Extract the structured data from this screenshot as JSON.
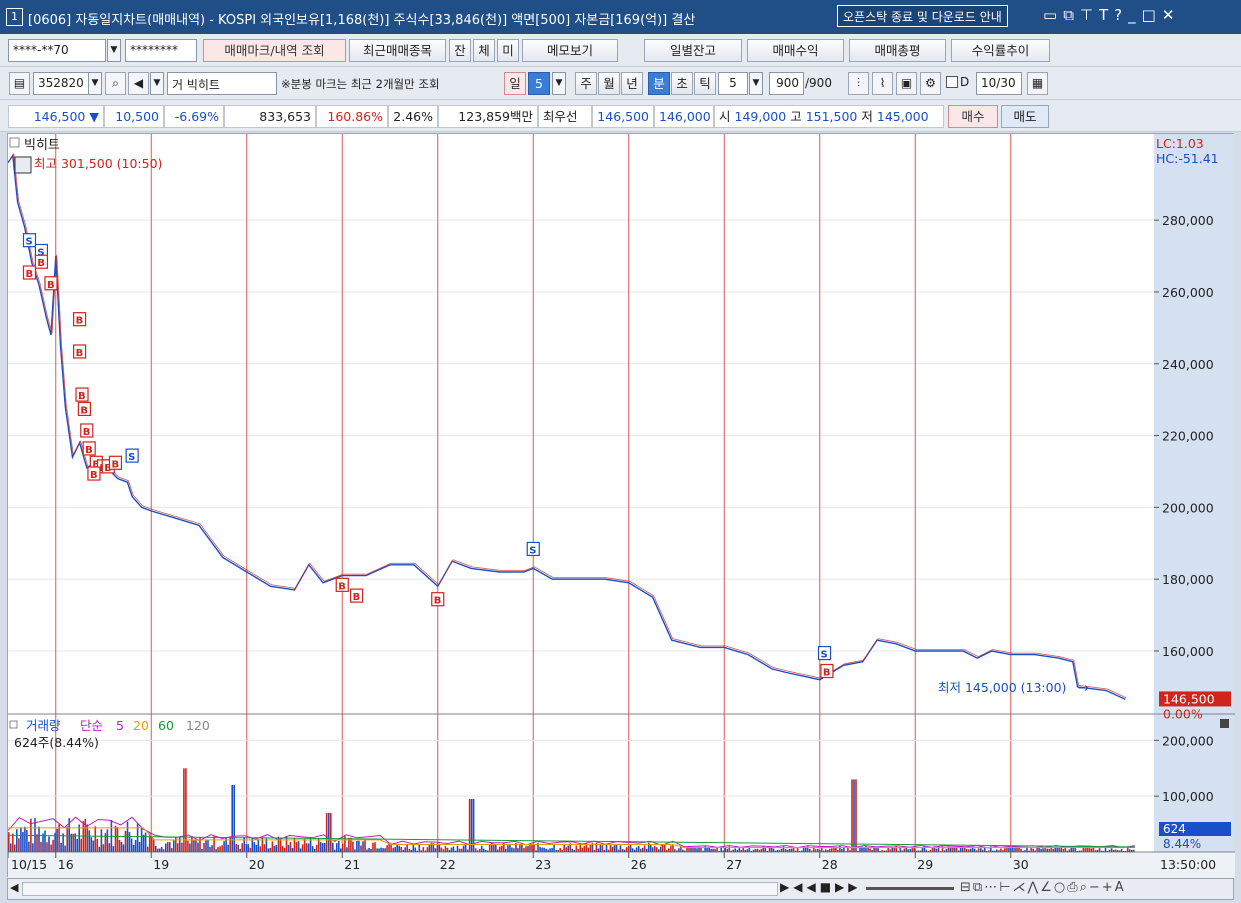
{
  "window": {
    "screen_no": "1",
    "title": "[0606] 자동일지차트(매매내역) - KOSPI 외국인보유[1,168(천)] 주식수[33,846(천)] 액면[500] 자본금[169(억)] 결산",
    "notice_button": "오픈스탁 종료 및 다운로드 안내",
    "icons": [
      "restore-down-icon",
      "cascade-icon",
      "pin-icon",
      "font-icon",
      "help-icon",
      "minimize-icon",
      "maximize-icon",
      "close-icon"
    ]
  },
  "row1": {
    "account": "****-**70",
    "password": "********",
    "buttons": [
      "매매마크/내역 조회",
      "최근매매종목",
      "잔",
      "체",
      "미",
      "메모보기",
      "일별잔고",
      "매매수익",
      "매매총평",
      "수익률추이"
    ]
  },
  "row2": {
    "code": "352820",
    "name": "거 빅히트",
    "note": "※분봉 마크는 최근 2개월만 조회",
    "period_buttons": [
      "일",
      "5",
      "주",
      "월",
      "년",
      "분",
      "초",
      "틱"
    ],
    "interval": "5",
    "count": "900",
    "count_total": "/900",
    "date": "10/30",
    "d_label": "D"
  },
  "quote": {
    "price": "146,500",
    "change": "10,500",
    "change_pct": "-6.69%",
    "volume": "833,653",
    "vol_ratio": "160.86%",
    "turnover": "2.46%",
    "amount": "123,859백만",
    "best_label": "최우선",
    "best_ask": "146,500",
    "best_bid": "146,000",
    "open_label": "시",
    "open": "149,000",
    "high_label": "고",
    "high": "151,500",
    "low_label": "저",
    "low": "145,000",
    "buy_label": "매수",
    "sell_label": "매도"
  },
  "chart_data": {
    "type": "line",
    "stock_label": "빅히트",
    "lc": "LC:1.03",
    "hc": "HC:-51.41",
    "high_label": "최고 301,500 (10:50)",
    "low_label": "최저 145,000 (13:00)",
    "current_price": "146,500",
    "current_pct": "0.00%",
    "ylim": [
      143000,
      304000
    ],
    "y_ticks": [
      160000,
      180000,
      200000,
      220000,
      240000,
      260000,
      280000
    ],
    "y_tick_labels": [
      "160,000",
      "180,000",
      "200,000",
      "220,000",
      "240,000",
      "260,000",
      "280,000"
    ],
    "date_labels": [
      "10/15",
      "16",
      "19",
      "20",
      "21",
      "22",
      "23",
      "26",
      "27",
      "28",
      "29",
      "30"
    ],
    "time_label": "13:50:00",
    "price_path": [
      [
        0,
        296000
      ],
      [
        0.1,
        298000
      ],
      [
        0.2,
        285000
      ],
      [
        0.35,
        278000
      ],
      [
        0.5,
        268000
      ],
      [
        0.65,
        262000
      ],
      [
        0.8,
        253000
      ],
      [
        0.9,
        248000
      ],
      [
        1.0,
        270000
      ],
      [
        1.1,
        245000
      ],
      [
        1.2,
        228000
      ],
      [
        1.35,
        214000
      ],
      [
        1.5,
        218000
      ],
      [
        1.65,
        211000
      ],
      [
        1.8,
        212000
      ],
      [
        2.0,
        212000
      ],
      [
        2.3,
        208000
      ],
      [
        2.5,
        207000
      ],
      [
        2.6,
        203000
      ],
      [
        2.8,
        200000
      ],
      [
        3.0,
        199000
      ],
      [
        3.5,
        197000
      ],
      [
        4.0,
        195000
      ],
      [
        4.5,
        186000
      ],
      [
        5.0,
        182000
      ],
      [
        5.5,
        178000
      ],
      [
        6.0,
        177000
      ],
      [
        6.3,
        184000
      ],
      [
        6.6,
        179000
      ],
      [
        7.0,
        181000
      ],
      [
        7.5,
        181000
      ],
      [
        8.0,
        184000
      ],
      [
        8.5,
        184000
      ],
      [
        9.0,
        178000
      ],
      [
        9.3,
        185000
      ],
      [
        9.7,
        183000
      ],
      [
        10.3,
        182000
      ],
      [
        10.8,
        182000
      ],
      [
        11.0,
        183000
      ],
      [
        11.4,
        180000
      ],
      [
        12.0,
        180000
      ],
      [
        12.5,
        180000
      ],
      [
        13.0,
        179000
      ],
      [
        13.5,
        175000
      ],
      [
        13.9,
        163000
      ],
      [
        14.5,
        161000
      ],
      [
        15.0,
        161000
      ],
      [
        15.5,
        159000
      ],
      [
        16.0,
        155000
      ],
      [
        16.3,
        154000
      ],
      [
        17.0,
        152000
      ],
      [
        17.5,
        156000
      ],
      [
        17.9,
        157000
      ],
      [
        18.2,
        163000
      ],
      [
        18.6,
        162000
      ],
      [
        19.0,
        160000
      ],
      [
        19.5,
        160000
      ],
      [
        20.0,
        160000
      ],
      [
        20.3,
        158000
      ],
      [
        20.6,
        160000
      ],
      [
        21.0,
        159000
      ],
      [
        21.5,
        159000
      ],
      [
        22.0,
        158000
      ],
      [
        22.3,
        157000
      ],
      [
        22.4,
        150000
      ],
      [
        23.0,
        149000
      ],
      [
        23.4,
        146500
      ]
    ],
    "day_lines": [
      1,
      3,
      5,
      7,
      9,
      11,
      13,
      15,
      17,
      19,
      21
    ],
    "markers": [
      {
        "t": "S",
        "x": 0.45,
        "y": 274000
      },
      {
        "t": "S",
        "x": 0.7,
        "y": 271000
      },
      {
        "t": "B",
        "x": 0.45,
        "y": 265000
      },
      {
        "t": "B",
        "x": 0.7,
        "y": 268000
      },
      {
        "t": "B",
        "x": 0.9,
        "y": 262000
      },
      {
        "t": "B",
        "x": 1.5,
        "y": 252000
      },
      {
        "t": "B",
        "x": 1.5,
        "y": 243000
      },
      {
        "t": "B",
        "x": 1.55,
        "y": 231000
      },
      {
        "t": "B",
        "x": 1.6,
        "y": 227000
      },
      {
        "t": "B",
        "x": 1.65,
        "y": 221000
      },
      {
        "t": "B",
        "x": 1.7,
        "y": 216000
      },
      {
        "t": "B",
        "x": 1.85,
        "y": 212000
      },
      {
        "t": "B",
        "x": 2.0,
        "y": 211000
      },
      {
        "t": "B",
        "x": 2.1,
        "y": 211000
      },
      {
        "t": "B",
        "x": 2.25,
        "y": 212000
      },
      {
        "t": "B",
        "x": 1.8,
        "y": 209000
      },
      {
        "t": "S",
        "x": 2.6,
        "y": 214000
      },
      {
        "t": "B",
        "x": 7.0,
        "y": 178000
      },
      {
        "t": "B",
        "x": 7.3,
        "y": 175000
      },
      {
        "t": "B",
        "x": 9.0,
        "y": 174000
      },
      {
        "t": "S",
        "x": 11.0,
        "y": 188000
      },
      {
        "t": "S",
        "x": 17.1,
        "y": 159000
      },
      {
        "t": "B",
        "x": 17.15,
        "y": 154000
      }
    ],
    "volume_panel": {
      "label": "거래량",
      "ma_label": "단순",
      "ma_periods": [
        "5",
        "20",
        "60",
        "120"
      ],
      "info": "624주(8.44%)",
      "y_ticks": [
        100000,
        200000
      ],
      "y_tick_labels": [
        "100,000",
        "200,000"
      ],
      "ylim": [
        0,
        240000
      ],
      "current": "624",
      "current_pct": "8.44%"
    }
  },
  "bottom": {
    "icons": [
      "scroll-left-icon",
      "play-icon",
      "rewind-icon",
      "stop-icon",
      "fast-forward-icon",
      "zoom-slider-icon",
      "chart-icon-1",
      "chart-icon-2",
      "chart-icon-3",
      "draw-line-icon",
      "draw-fan-icon",
      "draw-trend-icon",
      "draw-angle-icon",
      "draw-circle-icon",
      "snapshot-icon",
      "search-zoom-icon",
      "zoom-out-icon",
      "zoom-in-icon",
      "reset-icon"
    ]
  },
  "colors": {
    "title_bg": "#1f4f86",
    "red": "#d0241c",
    "blue": "#1a4fc9",
    "day_line": "#e0584f",
    "axis_bg": "#d5e1f0"
  }
}
